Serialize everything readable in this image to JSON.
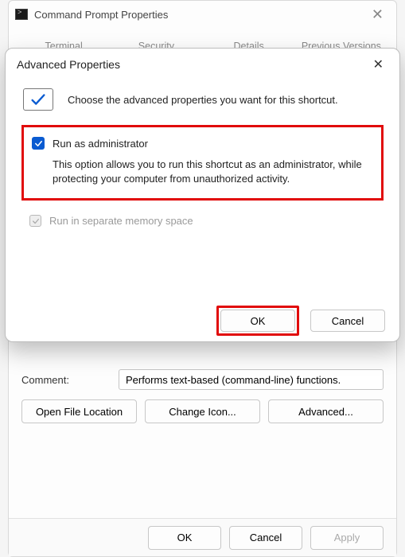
{
  "parent": {
    "title": "Command Prompt Properties",
    "tabs": [
      "Terminal",
      "Security",
      "Details",
      "Previous Versions"
    ],
    "comment_label": "Comment:",
    "comment_value": "Performs text-based (command-line) functions.",
    "buttons": {
      "open_location": "Open File Location",
      "change_icon": "Change Icon...",
      "advanced": "Advanced..."
    },
    "footer": {
      "ok": "OK",
      "cancel": "Cancel",
      "apply": "Apply"
    }
  },
  "dialog": {
    "title": "Advanced Properties",
    "intro": "Choose the advanced properties you want for this shortcut.",
    "run_admin_label": "Run as administrator",
    "run_admin_desc": "This option allows you to run this shortcut as an administrator, while protecting your computer from unauthorized activity.",
    "separate_mem_label": "Run in separate memory space",
    "ok": "OK",
    "cancel": "Cancel"
  }
}
